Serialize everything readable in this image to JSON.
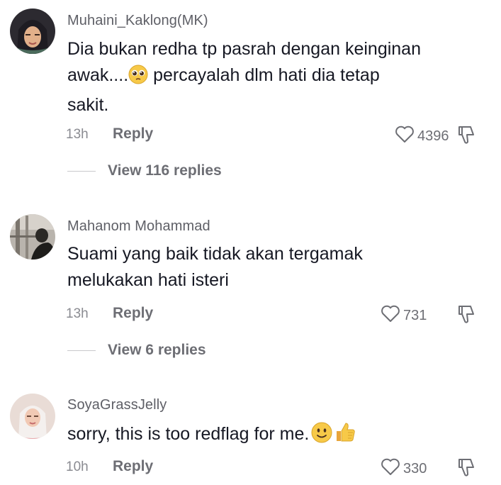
{
  "comments": [
    {
      "username": "Muhaini_Kaklong(MK)",
      "text_line1": "Dia bukan redha tp pasrah dengan keinginan",
      "text_line2_before": "awak....",
      "text_line2_emoji": "pleading-face-emoji",
      "text_line2_after": " percayalah dlm hati dia tetap",
      "text_line3": "sakit.",
      "time": "13h",
      "reply_label": "Reply",
      "likes": "4396",
      "view_replies": "View 116 replies"
    },
    {
      "username": "Mahanom Mohammad",
      "text_line1": "Suami yang baik tidak akan tergamak",
      "text_line2": "melukakan hati isteri",
      "time": "13h",
      "reply_label": "Reply",
      "likes": "731",
      "view_replies": "View 6 replies"
    },
    {
      "username": "SoyaGrassJelly",
      "text_line1": "sorry, this is too redflag for me.",
      "text_emojis": [
        "slightly-smiling-face-emoji",
        "thumbs-up-emoji"
      ],
      "time": "10h",
      "reply_label": "Reply",
      "likes": "330"
    }
  ],
  "icons": {
    "like": "heart-outline-icon",
    "dislike": "thumbs-down-outline-icon"
  },
  "colors": {
    "text": "#161823",
    "secondary": "#6d6e74",
    "username": "#5e5f66"
  }
}
